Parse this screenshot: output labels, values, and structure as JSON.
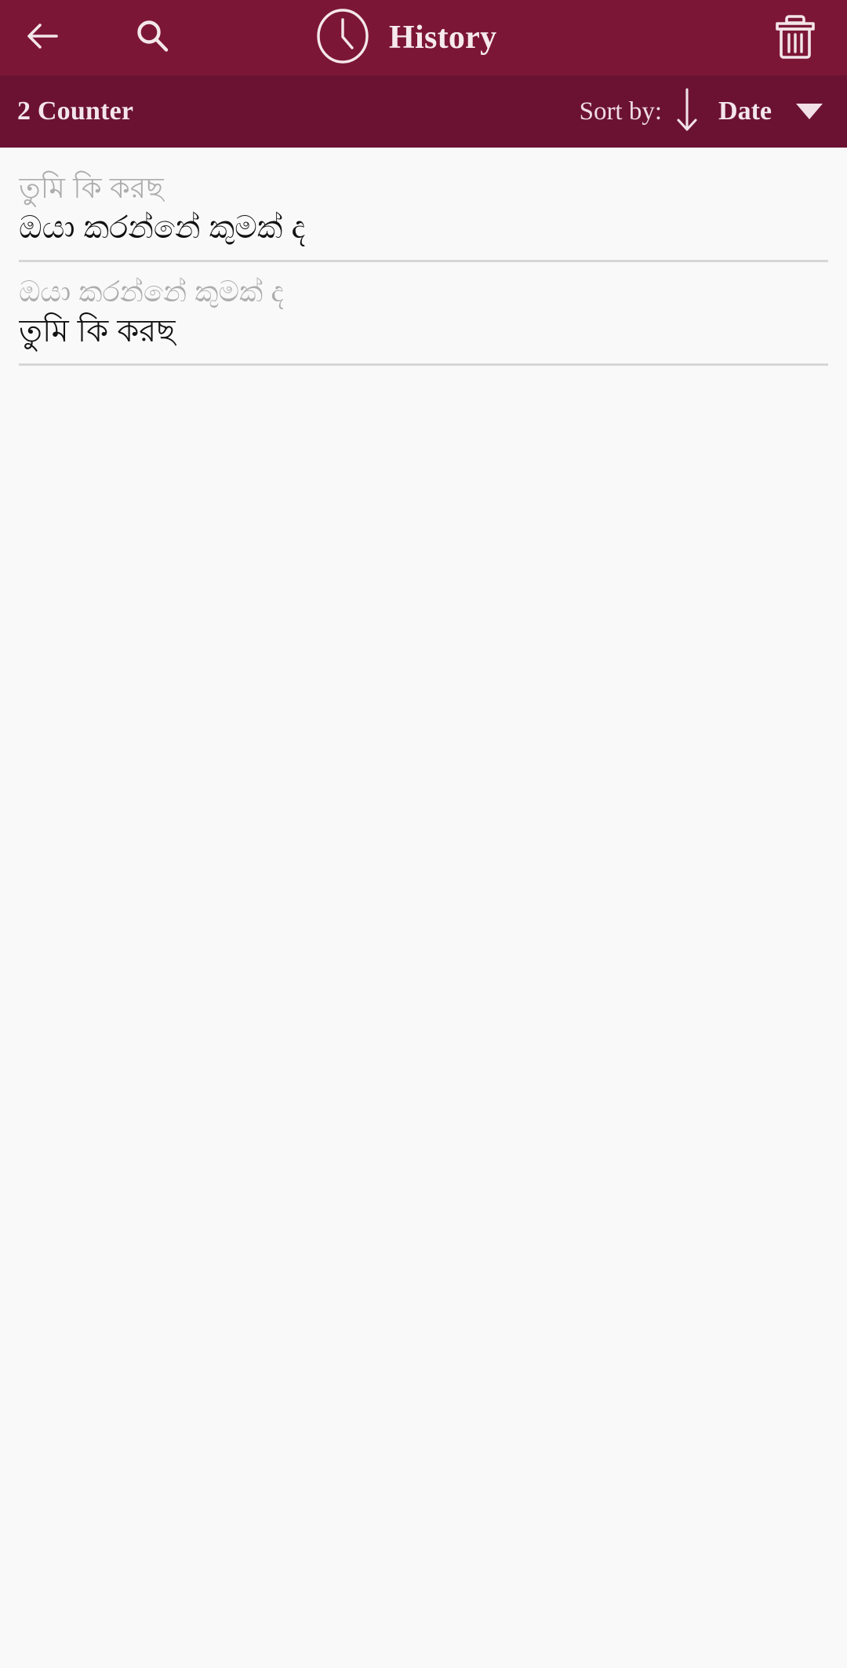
{
  "appbar": {
    "background": "#7c1637",
    "back_icon": "back-arrow-icon",
    "search_icon": "search-icon",
    "clock_icon": "clock-icon",
    "title": "History",
    "delete_icon": "trash-icon"
  },
  "sortbar": {
    "background": "#6b1232",
    "counter_label": "2 Counter",
    "sort_by_label": "Sort by:",
    "sort_direction_icon": "arrow-down-icon",
    "sort_field": "Date",
    "dropdown_icon": "caret-down-icon"
  },
  "history": {
    "items": [
      {
        "source_text": "তুমি কি করছ",
        "target_text": "ඔයා කරන්නේ කුමක් ද"
      },
      {
        "source_text": "ඔයා කරන්නේ කුමක් ද",
        "target_text": "তুমি কি করছ"
      }
    ]
  },
  "colors": {
    "appbar": "#7c1637",
    "sortbar": "#6b1232",
    "page_background": "#f9f9f9",
    "source_text": "#adadad",
    "target_text": "#111111",
    "divider": "#d6d6d6"
  }
}
